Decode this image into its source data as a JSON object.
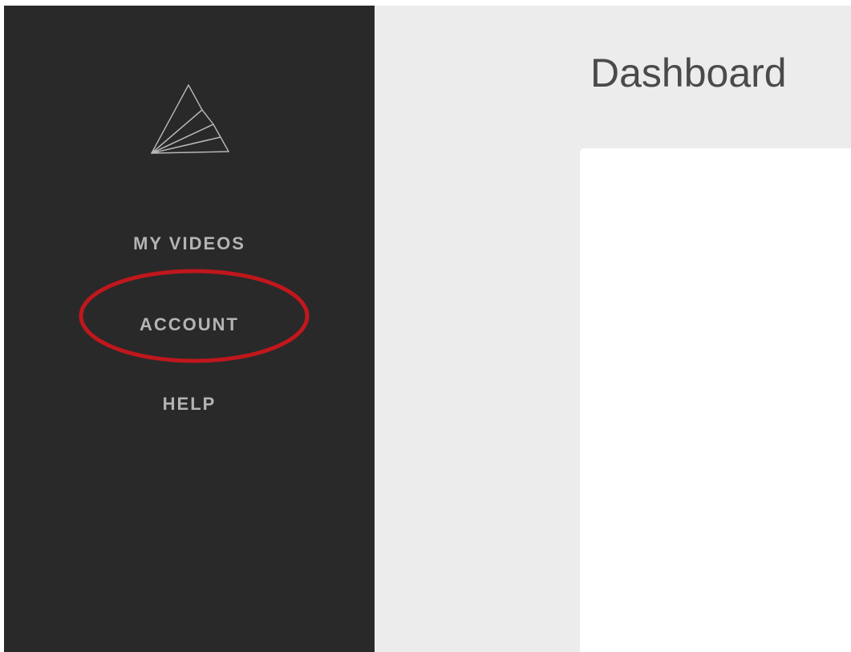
{
  "sidebar": {
    "logo_icon": "paper-fan-logo-icon",
    "items": [
      {
        "label": "MY VIDEOS"
      },
      {
        "label": "ACCOUNT",
        "highlighted": true
      },
      {
        "label": "HELP"
      }
    ]
  },
  "header": {
    "title": "Dashboard"
  },
  "colors": {
    "sidebar_bg": "#292929",
    "nav_text": "#b4b4b4",
    "main_bg": "#ececec",
    "card_bg": "#ffffff",
    "highlight_ring": "#c0171c",
    "title_text": "#4a4a4a"
  }
}
